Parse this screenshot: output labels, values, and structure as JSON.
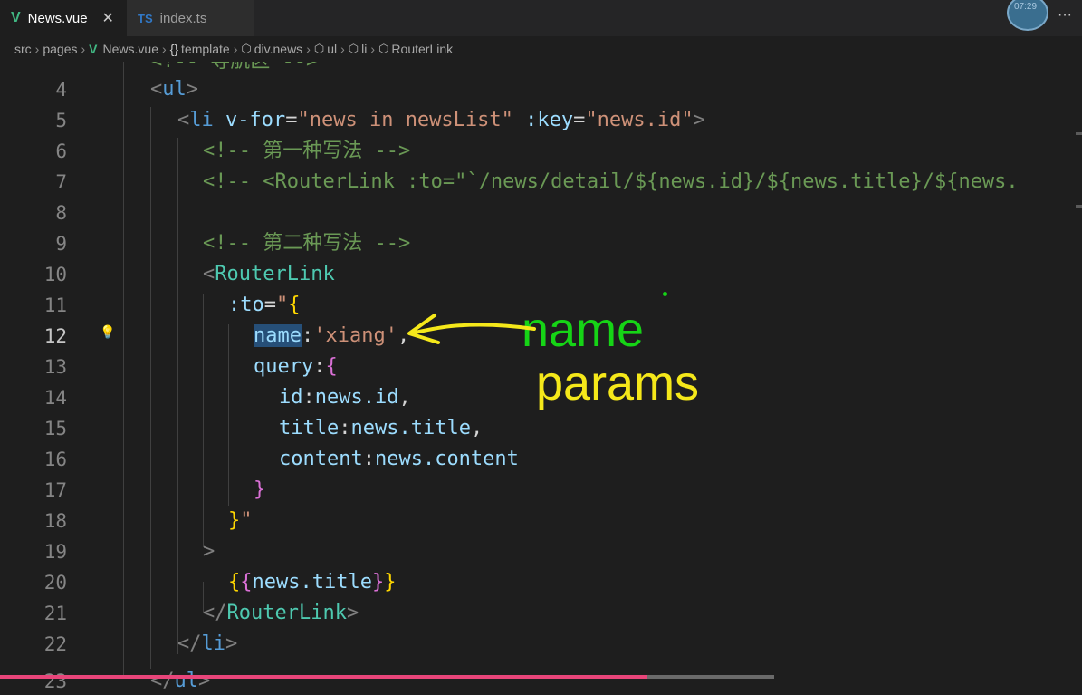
{
  "tabs": [
    {
      "icon": "V",
      "label": "News.vue",
      "close": "✕"
    },
    {
      "icon": "TS",
      "label": "index.ts"
    }
  ],
  "avatar_time": "07:29",
  "more": "···",
  "breadcrumb": {
    "src": "src",
    "pages": "pages",
    "file": "News.vue",
    "template_icon": "{}",
    "template": "template",
    "div": "div.news",
    "ul": "ul",
    "li": "li",
    "routerlink": "RouterLink"
  },
  "lines": [
    {
      "n": "4"
    },
    {
      "n": "5"
    },
    {
      "n": "6"
    },
    {
      "n": "7"
    },
    {
      "n": "8"
    },
    {
      "n": "9"
    },
    {
      "n": "10"
    },
    {
      "n": "11"
    },
    {
      "n": "12"
    },
    {
      "n": "13"
    },
    {
      "n": "14"
    },
    {
      "n": "15"
    },
    {
      "n": "16"
    },
    {
      "n": "17"
    },
    {
      "n": "18"
    },
    {
      "n": "19"
    },
    {
      "n": "20"
    },
    {
      "n": "21"
    },
    {
      "n": "22"
    },
    {
      "n": "23"
    }
  ],
  "code": {
    "l3": "<!-- 导航区 -->",
    "ul_open": "ul",
    "li_tag": "li",
    "li_vfor": "v-for",
    "li_vfor_val": "\"news in newsList\"",
    "li_key": ":key",
    "li_key_val": "\"news.id\"",
    "c1": "<!-- 第一种写法 -->",
    "c2": "<!-- <RouterLink :to=\"`/news/detail/${news.id}/${news.title}/${news.",
    "c3": "<!-- 第二种写法 -->",
    "rl": "RouterLink",
    "to": ":to",
    "name_key": "name",
    "name_val": "'xiang'",
    "query": "query",
    "id": "id",
    "id_val": "news.id",
    "title": "title",
    "title_val": "news.title",
    "content": "content",
    "content_val": "news.content",
    "interp": "news.title",
    "rl_close": "RouterLink",
    "li_close": "li",
    "ul_close": "ul"
  },
  "annotations": {
    "name": "name",
    "params": "params"
  },
  "colors": {
    "annotation_green": "#16d416",
    "annotation_yellow": "#f5e81a",
    "vue_green": "#41b883",
    "ts_blue": "#3178c6"
  }
}
